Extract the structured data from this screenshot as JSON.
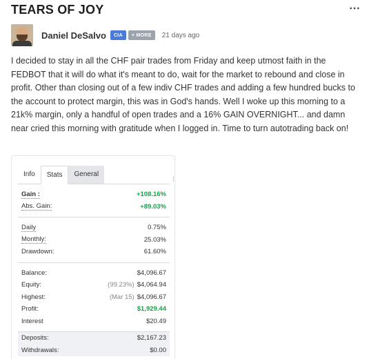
{
  "post": {
    "title": "TEARS OF JOY",
    "more_menu": "⋯",
    "author": "Daniel DeSalvo",
    "badges": [
      "CIA",
      "+ MORE"
    ],
    "time": "21 days ago",
    "body": "I decided to stay in all the CHF pair trades from Friday and keep utmost faith in the FEDBOT that it will do what it's meant to do, wait for the market to rebound and close in profit. Other than closing out of a few indiv CHF trades and adding a few hundred bucks to the account to protect margin, this was in God's hands. Well I woke up this morning to a 21k% margin, only a handful of open trades and a 16% GAIN OVERNIGHT... and damn near cried this morning with gratitude when I logged in. Time to turn autotrading back on!"
  },
  "stats": {
    "tabs": [
      "Info",
      "Stats",
      "General"
    ],
    "active_tab": "Stats",
    "gain_label": "Gain :",
    "gain_value": "+108.16%",
    "abs_gain_label": "Abs. Gain:",
    "abs_gain_value": "+89.03%",
    "daily_label": "Daily",
    "daily_value": "0.75%",
    "monthly_label": "Monthly:",
    "monthly_value": "25.03%",
    "drawdown_label": "Drawdown:",
    "drawdown_value": "61.60%",
    "balance_label": "Balance:",
    "balance_value": "$4,096.67",
    "equity_label": "Equity:",
    "equity_note": "(99.23%)",
    "equity_value": "$4,064.94",
    "highest_label": "Highest:",
    "highest_note": "(Mar 15)",
    "highest_value": "$4,096.67",
    "profit_label": "Profit:",
    "profit_value": "$1,929.44",
    "interest_label": "Interest",
    "interest_value": "$20.49",
    "deposits_label": "Deposits:",
    "deposits_value": "$2,167.23",
    "withdrawals_label": "Withdrawals:",
    "withdrawals_value": "$0.00"
  },
  "colors": {
    "badge_cia": "#4a7bd8",
    "badge_more": "#9aa3b0",
    "positive": "#1aa24b"
  }
}
